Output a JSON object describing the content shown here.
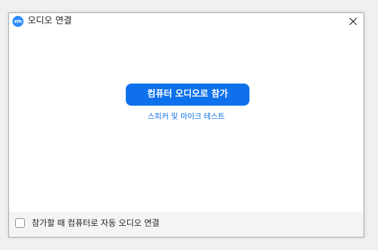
{
  "window": {
    "app_logo_text": "zm",
    "title": "오디오 연결",
    "close_icon": "close-icon"
  },
  "main": {
    "join_button_label": "컴퓨터 오디오로 참가",
    "test_link_label": "스피커 및 마이크 테스트"
  },
  "footer": {
    "auto_connect_label": "참가할 때 컴퓨터로 자동 오디오 연결",
    "auto_connect_checked": false
  },
  "colors": {
    "accent": "#0E71EB",
    "logo": "#2D8CFF"
  }
}
